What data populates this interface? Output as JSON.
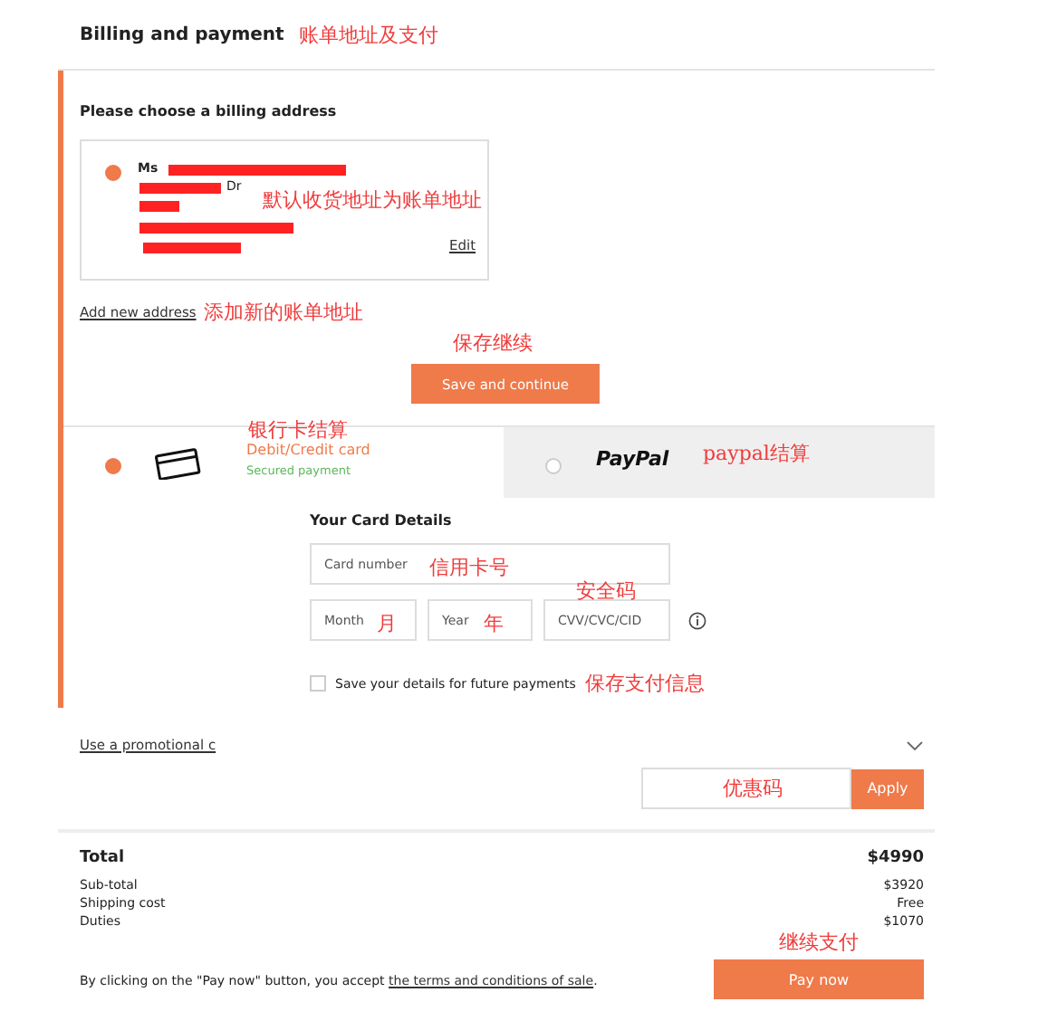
{
  "header": {
    "title": "Billing and payment",
    "annotation": "账单地址及支付"
  },
  "billing": {
    "heading": "Please choose a billing address",
    "address": {
      "selected": true,
      "salutation": "Ms",
      "fragment": "Dr",
      "edit": "Edit",
      "annotation": "默认收货地址为账单地址"
    },
    "add_link": "Add new address",
    "add_annotation": "添加新的账单地址",
    "save_button": "Save and continue",
    "save_annotation": "保存继续"
  },
  "payment_methods": [
    {
      "kind": "card",
      "selected": true,
      "title": "Debit/Credit card",
      "subtitle": "Secured payment",
      "annotation": "银行卡结算"
    },
    {
      "kind": "paypal",
      "selected": false,
      "title": "PayPal",
      "annotation": "paypal结算"
    }
  ],
  "card_details": {
    "heading": "Your Card Details",
    "card_number": {
      "placeholder": "Card number",
      "annotation": "信用卡号"
    },
    "month": {
      "placeholder": "Month",
      "annotation": "月"
    },
    "year": {
      "placeholder": "Year",
      "annotation": "年"
    },
    "cvv": {
      "placeholder": "CVV/CVC/CID",
      "annotation": "安全码"
    },
    "save_details": {
      "label": "Save your details for future payments",
      "checked": false,
      "annotation": "保存支付信息"
    }
  },
  "promo": {
    "link": "Use a promotional c",
    "field_annotation": "优惠码",
    "apply": "Apply"
  },
  "totals": {
    "label": "Total",
    "amount": "$4990",
    "rows": [
      {
        "label": "Sub-total",
        "value": "$3920"
      },
      {
        "label": "Shipping cost",
        "value": "Free"
      },
      {
        "label": "Duties",
        "value": "$1070"
      }
    ],
    "terms_text": "By clicking on the \"Pay now\" button, you accept",
    "terms_link": "the terms and conditions of sale",
    "terms_end": ".",
    "pay_button": "Pay now",
    "pay_annotation": "继续支付"
  }
}
